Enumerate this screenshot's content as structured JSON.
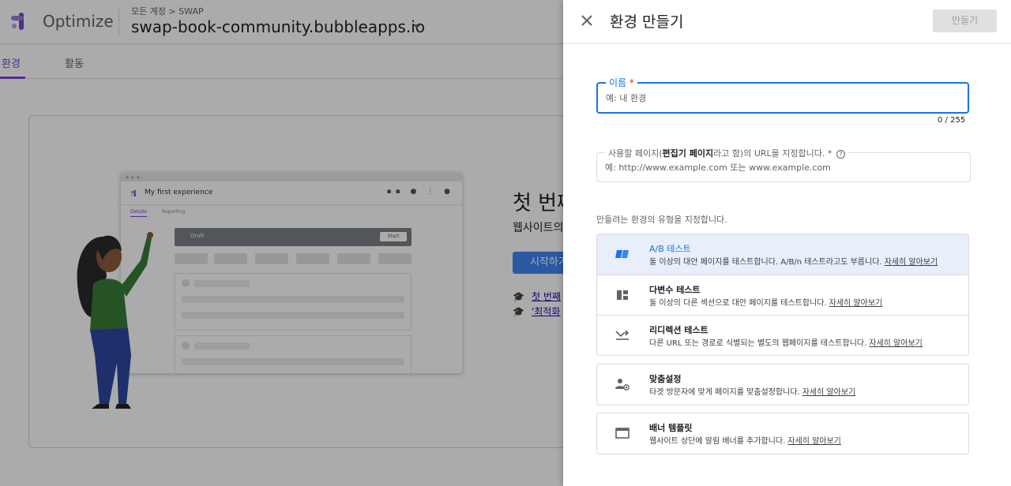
{
  "app": {
    "brand": "Optimize",
    "breadcrumb": "모든 계정 > SWAP",
    "container_name": "swap-book-community.bubbleapps.io"
  },
  "tabs": [
    {
      "label": "환경",
      "active": true
    },
    {
      "label": "활동",
      "active": false
    }
  ],
  "illustration": {
    "title": "My first experience",
    "tab_details": "Details",
    "tab_reporting": "Reporting",
    "draft_label": "Draft",
    "start_label": "Start"
  },
  "hero": {
    "title": "첫 번째",
    "subtitle": "웹사이트의",
    "start_button": "시작하기",
    "links": [
      "첫 번째",
      "'최적화"
    ]
  },
  "panel": {
    "title": "환경 만들기",
    "create_button": "만들기",
    "name_field": {
      "label": "이름",
      "required_mark": "*",
      "placeholder": "예: 내 환경",
      "value": "",
      "counter": "0 / 255"
    },
    "url_field": {
      "label_pre": "사용할 페이지(",
      "label_bold": "편집기 페이지",
      "label_post": "라고 함)의 URL을 지정합니다. *",
      "help_icon": "?",
      "placeholder": "예: http://www.example.com 또는 www.example.com",
      "value": ""
    },
    "type_prompt": "만들려는 환경의 유형을 지정합니다.",
    "learn_more": "자세히 알아보기",
    "types_group1": [
      {
        "icon": "ab-test-icon",
        "title": "A/B 테스트",
        "desc": "둘 이상의 대안 페이지를 테스트합니다. A/B/n 테스트라고도 부릅니다.",
        "selected": true
      },
      {
        "icon": "multivariate-icon",
        "title": "다변수 테스트",
        "desc": "둘 이상의 다른 섹션으로 대안 페이지를 테스트합니다.",
        "selected": false
      },
      {
        "icon": "redirect-icon",
        "title": "리디렉션 테스트",
        "desc": "다른 URL 또는 경로로 식별되는 별도의 웹페이지를 테스트합니다.",
        "selected": false
      }
    ],
    "types_group2": [
      {
        "icon": "personalization-icon",
        "title": "맞춤설정",
        "desc": "타겟 방문자에 맞게 페이지를 맞춤설정합니다."
      }
    ],
    "types_group3": [
      {
        "icon": "banner-icon",
        "title": "배너 템플릿",
        "desc": "웹사이트 상단에 알림 배너를 추가합니다."
      }
    ]
  },
  "colors": {
    "accent": "#1a73e8",
    "brand_purple": "#7b42d6",
    "selected_bg": "#e8eefa"
  }
}
